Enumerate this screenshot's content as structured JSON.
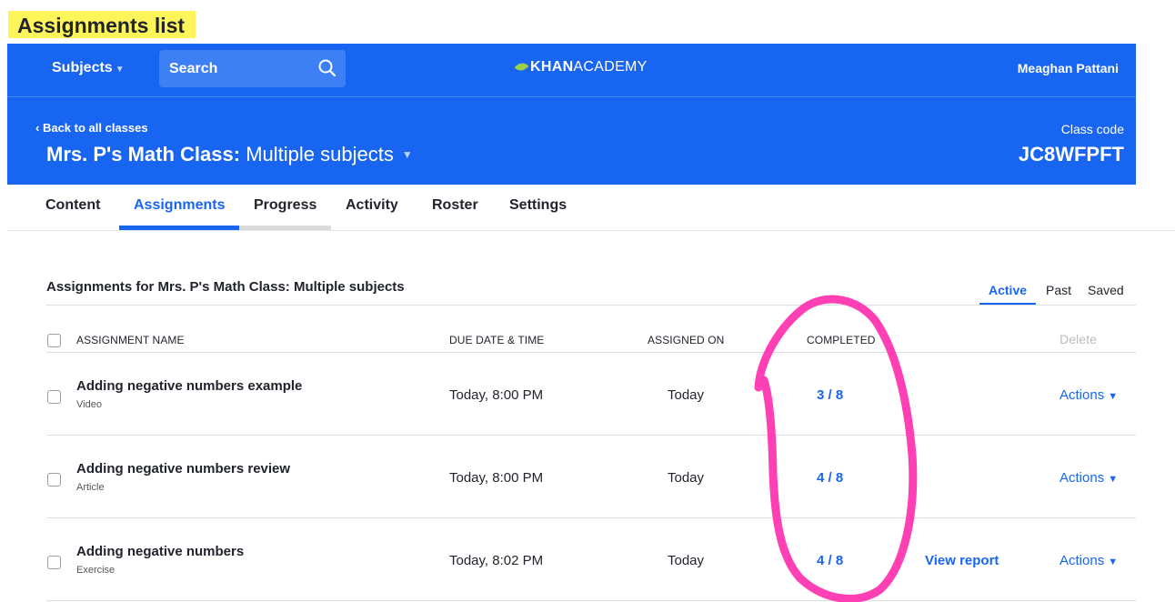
{
  "page_label": "Assignments list",
  "topbar": {
    "subjects_label": "Subjects",
    "search_label": "Search",
    "logo_strong": "KHAN",
    "logo_light": "ACADEMY",
    "user_name": "Meaghan Pattani",
    "brand_color": "#1865f2"
  },
  "class_header": {
    "back_label": "Back to all classes",
    "class_name": "Mrs. P's Math Class:",
    "class_subjects": "Multiple subjects",
    "code_label": "Class code",
    "code_value": "JC8WFPFT"
  },
  "tabs": [
    "Content",
    "Assignments",
    "Progress",
    "Activity",
    "Roster",
    "Settings"
  ],
  "active_tab": "Assignments",
  "section": {
    "title": "Assignments for Mrs. P's Math Class: Multiple subjects",
    "filters": [
      "Active",
      "Past",
      "Saved"
    ],
    "active_filter": "Active"
  },
  "table": {
    "headers": {
      "name": "ASSIGNMENT NAME",
      "due": "DUE DATE & TIME",
      "assigned": "ASSIGNED ON",
      "completed": "COMPLETED",
      "delete": "Delete"
    },
    "rows": [
      {
        "name": "Adding negative numbers example",
        "type": "Video",
        "due": "Today, 8:00 PM",
        "assigned": "Today",
        "completed": "3 / 8",
        "report": "",
        "actions": "Actions"
      },
      {
        "name": "Adding negative numbers review",
        "type": "Article",
        "due": "Today, 8:00 PM",
        "assigned": "Today",
        "completed": "4 / 8",
        "report": "",
        "actions": "Actions"
      },
      {
        "name": "Adding negative numbers",
        "type": "Exercise",
        "due": "Today, 8:02 PM",
        "assigned": "Today",
        "completed": "4 / 8",
        "report": "View report",
        "actions": "Actions"
      }
    ]
  },
  "annotation_color": "#ff3fb4"
}
